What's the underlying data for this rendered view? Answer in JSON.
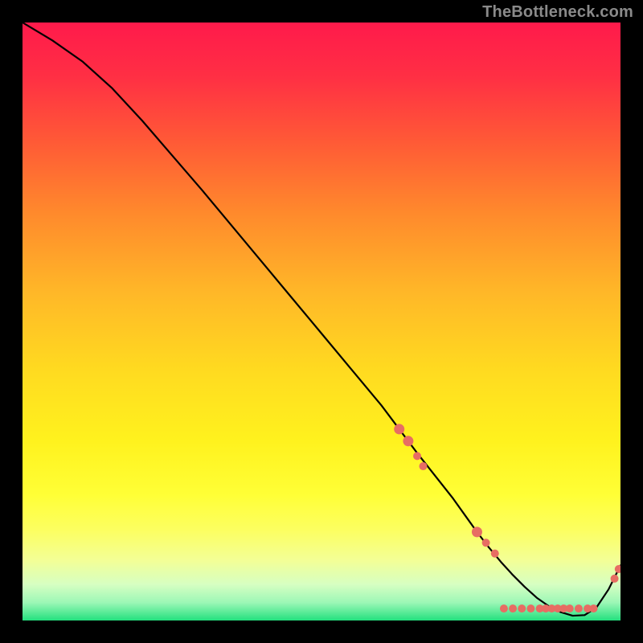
{
  "watermark": "TheBottleneck.com",
  "chart_data": {
    "type": "line",
    "title": "",
    "xlabel": "",
    "ylabel": "",
    "xlim": [
      0,
      100
    ],
    "ylim": [
      0,
      100
    ],
    "grid": false,
    "legend": false,
    "background_gradient": {
      "top_color": "#ff1a4b",
      "mid_colors": [
        "#ff6e2f",
        "#ffb62a",
        "#ffe11f",
        "#ffff32",
        "#fdff6d",
        "#e6ffb8"
      ],
      "bottom_color": "#23e07e"
    },
    "series": [
      {
        "name": "bottleneck-curve",
        "stroke": "#000000",
        "x": [
          0,
          5,
          10,
          15,
          20,
          25,
          30,
          35,
          40,
          45,
          50,
          55,
          60,
          63,
          66,
          69,
          72,
          74,
          76,
          78,
          80,
          82,
          84,
          86,
          88,
          90,
          92,
          94,
          96,
          98,
          100
        ],
        "y": [
          100,
          97,
          93.5,
          89,
          83.6,
          77.8,
          72,
          66,
          60,
          54,
          48,
          42,
          36,
          32,
          28,
          24.2,
          20.4,
          17.6,
          14.8,
          12.2,
          9.8,
          7.6,
          5.6,
          3.8,
          2.4,
          1.4,
          0.8,
          0.9,
          2.2,
          5.2,
          9.2
        ]
      }
    ],
    "markers": {
      "name": "reference-points",
      "color": "#e76d63",
      "radius_small": 5,
      "radius_large": 6.5,
      "points": [
        {
          "x": 63.0,
          "y": 32.0,
          "r": "large"
        },
        {
          "x": 64.5,
          "y": 30.0,
          "r": "large"
        },
        {
          "x": 66.0,
          "y": 27.5,
          "r": "small"
        },
        {
          "x": 67.0,
          "y": 25.8,
          "r": "small"
        },
        {
          "x": 76.0,
          "y": 14.8,
          "r": "large"
        },
        {
          "x": 77.5,
          "y": 13.0,
          "r": "small"
        },
        {
          "x": 79.0,
          "y": 11.2,
          "r": "small"
        },
        {
          "x": 80.5,
          "y": 2.0,
          "r": "small"
        },
        {
          "x": 82.0,
          "y": 2.0,
          "r": "small"
        },
        {
          "x": 83.5,
          "y": 2.0,
          "r": "small"
        },
        {
          "x": 85.0,
          "y": 2.0,
          "r": "small"
        },
        {
          "x": 86.5,
          "y": 2.0,
          "r": "small"
        },
        {
          "x": 87.5,
          "y": 2.0,
          "r": "small"
        },
        {
          "x": 88.5,
          "y": 2.0,
          "r": "small"
        },
        {
          "x": 89.5,
          "y": 2.0,
          "r": "small"
        },
        {
          "x": 90.5,
          "y": 2.0,
          "r": "small"
        },
        {
          "x": 91.5,
          "y": 2.0,
          "r": "small"
        },
        {
          "x": 93.0,
          "y": 2.0,
          "r": "small"
        },
        {
          "x": 94.5,
          "y": 2.0,
          "r": "small"
        },
        {
          "x": 95.5,
          "y": 2.0,
          "r": "small"
        },
        {
          "x": 99.0,
          "y": 7.0,
          "r": "small"
        },
        {
          "x": 99.7,
          "y": 8.6,
          "r": "small"
        }
      ]
    }
  }
}
